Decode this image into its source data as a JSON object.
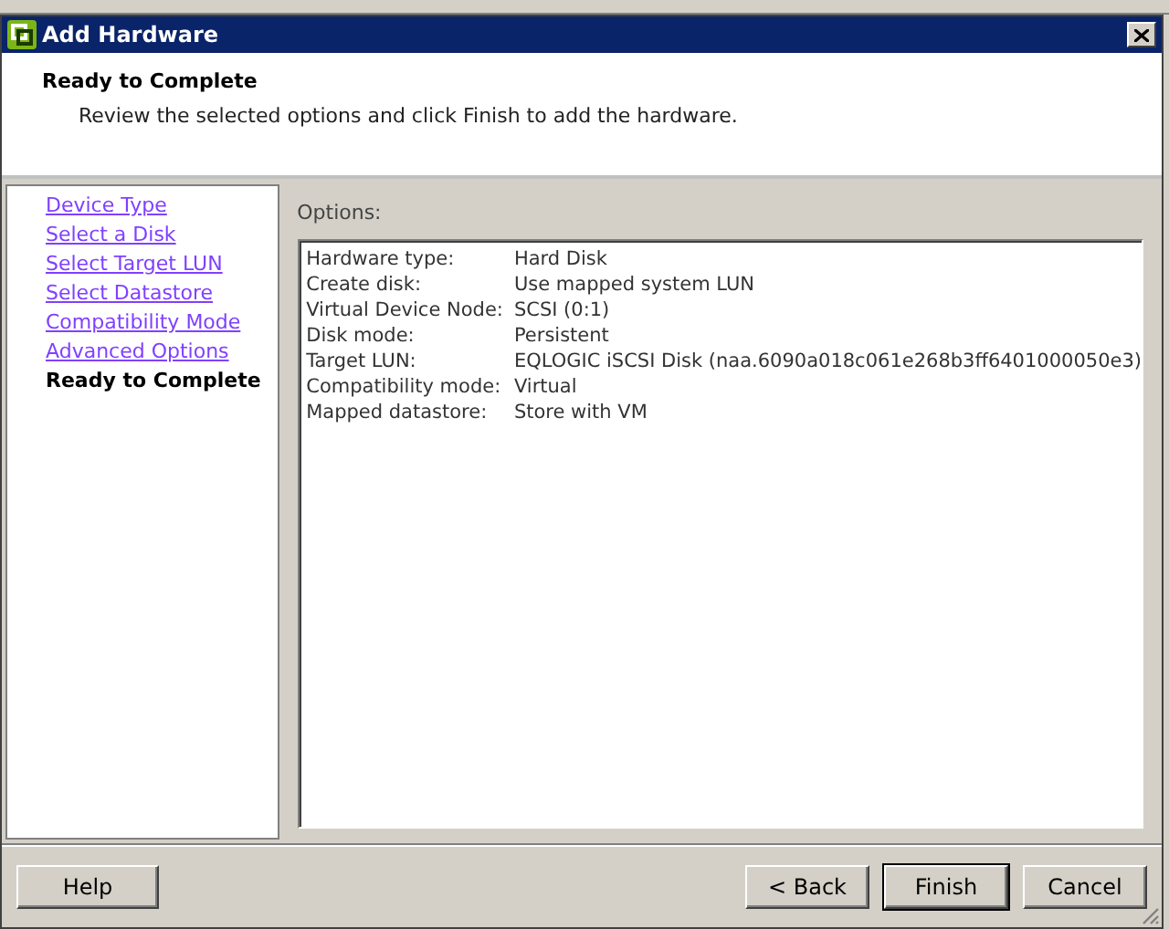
{
  "window": {
    "title": "Add Hardware"
  },
  "header": {
    "title": "Ready to Complete",
    "subtitle": "Review the selected options and click Finish to add the hardware."
  },
  "steps": [
    {
      "label": "Device Type",
      "selected": false
    },
    {
      "label": "Select a Disk",
      "selected": false
    },
    {
      "label": "Select Target LUN",
      "selected": false
    },
    {
      "label": "Select Datastore",
      "selected": false
    },
    {
      "label": "Compatibility Mode",
      "selected": false
    },
    {
      "label": "Advanced Options",
      "selected": false
    },
    {
      "label": "Ready to Complete",
      "selected": true
    }
  ],
  "options": {
    "label": "Options:",
    "rows": [
      {
        "name": "Hardware type:",
        "value": "Hard Disk"
      },
      {
        "name": "Create disk:",
        "value": "Use mapped system LUN"
      },
      {
        "name": "Virtual Device Node:",
        "value": "SCSI (0:1)"
      },
      {
        "name": "Disk mode:",
        "value": "Persistent"
      },
      {
        "name": "Target LUN:",
        "value": "EQLOGIC iSCSI Disk (naa.6090a018c061e268b3ff6401000050e3)"
      },
      {
        "name": "Compatibility mode:",
        "value": "Virtual"
      },
      {
        "name": "Mapped datastore:",
        "value": "Store with VM"
      }
    ]
  },
  "buttons": {
    "help": "Help",
    "back": "< Back",
    "finish": "Finish",
    "cancel": "Cancel"
  }
}
